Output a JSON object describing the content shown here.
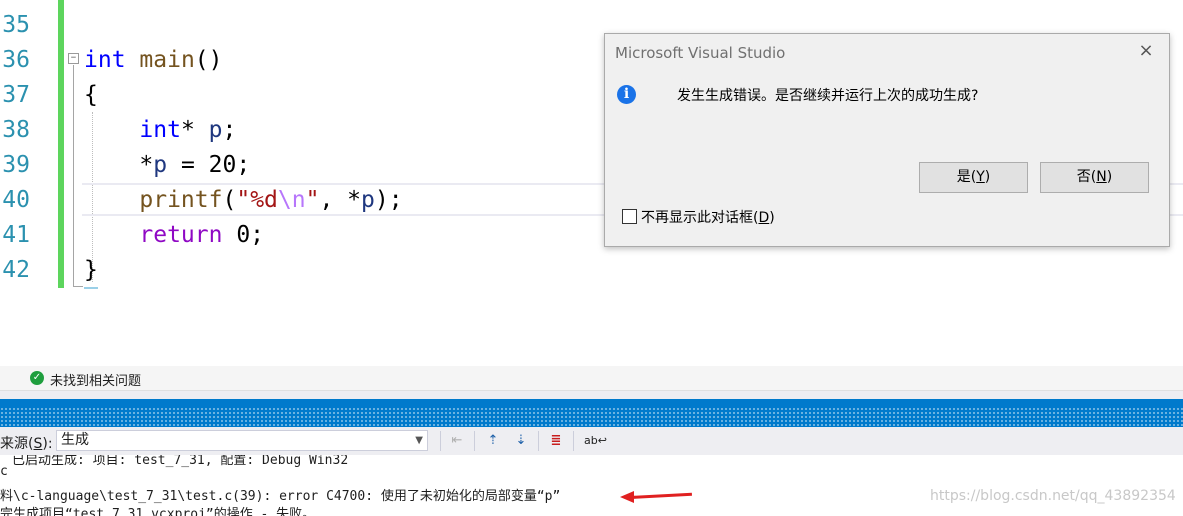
{
  "editor": {
    "line_numbers": [
      "35",
      "36",
      "37",
      "38",
      "39",
      "40",
      "41",
      "42"
    ],
    "code": {
      "l36_type": "int",
      "l36_func": "main",
      "l36_rest": "()",
      "l37": "{",
      "l38_type": "int",
      "l38_mid": "* ",
      "l38_var": "p",
      "l38_end": ";",
      "l39_star": "*",
      "l39_var": "p",
      "l39_rest": " = 20;",
      "l40_func": "printf",
      "l40_open": "(",
      "l40_str": "\"%d",
      "l40_esc": "\\n",
      "l40_strend": "\"",
      "l40_mid": ", *",
      "l40_var": "p",
      "l40_end": ");",
      "l41_kw": "return",
      "l41_rest": " 0;",
      "l42": "}"
    },
    "fold_symbol": "−"
  },
  "dialog": {
    "title": "Microsoft Visual Studio",
    "close": "×",
    "icon": "info-icon",
    "message": "发生生成错误。是否继续并运行上次的成功生成?",
    "yes_pre": "是(",
    "yes_key": "Y",
    "yes_post": ")",
    "no_pre": "否(",
    "no_key": "N",
    "no_post": ")",
    "checkbox_pre": "不再显示此对话框(",
    "checkbox_key": "D",
    "checkbox_post": ")"
  },
  "error_list": {
    "status_text": "未找到相关问题"
  },
  "output": {
    "source_label_pre": "来源(",
    "source_label_key": "S",
    "source_label_post": "):",
    "source_value": "生成",
    "lines": [
      "已启动生成: 项目: test_7_31, 配置: Debug Win32",
      "c",
      "料\\c-language\\test_7_31\\test.c(39): error C4700: 使用了未初始化的局部变量“p”",
      "完生成项目“test_7_31.vcxproj”的操作 - 失败。"
    ]
  },
  "watermark": "https://blog.csdn.net/qq_43892354",
  "colors": {
    "keyword": "#0000ff",
    "function": "#74531f",
    "variable": "#1f377f",
    "string": "#a31515",
    "output_accent": "#007acc",
    "change_bar": "#5dd55d",
    "annotation_arrow": "#e02020"
  }
}
